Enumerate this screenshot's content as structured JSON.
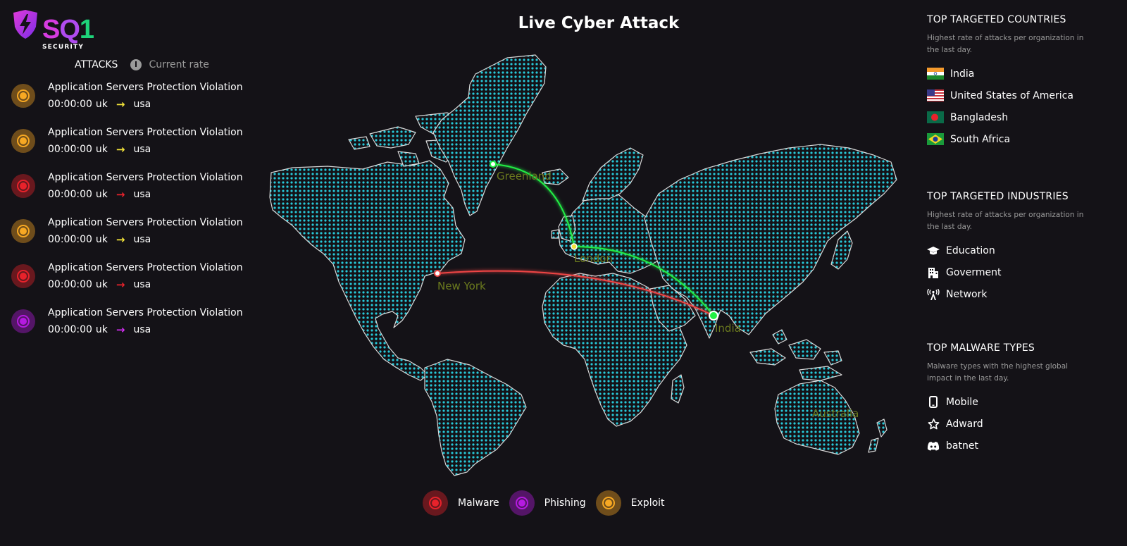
{
  "logo": {
    "text_s": "S",
    "text_q": "Q",
    "text_1": "1",
    "subtitle": "SECURITY"
  },
  "attacks_header": {
    "label": "ATTACKS",
    "rate_label": "Current rate",
    "rate_icon": "gauge-icon"
  },
  "attacks": [
    {
      "name": "Application Servers Protection Violation",
      "time": "00:00:00",
      "from": "uk",
      "to": "usa",
      "type": "exploit",
      "color": "#f7a823",
      "arrow_color": "#f2e33a"
    },
    {
      "name": "Application Servers Protection Violation",
      "time": "00:00:00",
      "from": "uk",
      "to": "usa",
      "type": "exploit",
      "color": "#f7a823",
      "arrow_color": "#f2e33a"
    },
    {
      "name": "Application Servers Protection Violation",
      "time": "00:00:00",
      "from": "uk",
      "to": "usa",
      "type": "malware",
      "color": "#e8222b",
      "arrow_color": "#e8222b"
    },
    {
      "name": "Application Servers Protection Violation",
      "time": "00:00:00",
      "from": "uk",
      "to": "usa",
      "type": "exploit",
      "color": "#f7a823",
      "arrow_color": "#f2e33a"
    },
    {
      "name": "Application Servers Protection Violation",
      "time": "00:00:00",
      "from": "uk",
      "to": "usa",
      "type": "malware",
      "color": "#e8222b",
      "arrow_color": "#e8222b"
    },
    {
      "name": "Application Servers Protection Violation",
      "time": "00:00:00",
      "from": "uk",
      "to": "usa",
      "type": "phishing",
      "color": "#b51be0",
      "arrow_color": "#d02ef0"
    }
  ],
  "title": "Live Cyber Attack",
  "map": {
    "labels": {
      "greenland": "Greenland",
      "new_york": "New York",
      "london": "London",
      "india": "India",
      "australia": "Australia"
    },
    "dot_color": "#27c8d8",
    "border_color": "#d8d8d8",
    "arc_green": "#22ee44",
    "arc_red": "#ef4545",
    "label_color": "#6b7a1e"
  },
  "legend": [
    {
      "label": "Malware",
      "color": "#e8222b"
    },
    {
      "label": "Phishing",
      "color": "#b51be0"
    },
    {
      "label": "Exploit",
      "color": "#f7a823"
    }
  ],
  "targeted_countries": {
    "title": "TOP TARGETED COUNTRIES",
    "description": "Highest rate of attacks per organization in the last day.",
    "items": [
      {
        "label": "India",
        "flag": "india-flag"
      },
      {
        "label": "United States of America",
        "flag": "usa-flag"
      },
      {
        "label": "Bangladesh",
        "flag": "bangladesh-flag"
      },
      {
        "label": "South Africa",
        "flag": "south-africa-flag"
      }
    ]
  },
  "targeted_industries": {
    "title": "TOP TARGETED INDUSTRIES",
    "description": "Highest rate of attacks per organization in the last day.",
    "items": [
      {
        "label": "Education",
        "icon": "graduation-cap-icon"
      },
      {
        "label": "Goverment",
        "icon": "building-icon"
      },
      {
        "label": "Network",
        "icon": "broadcast-tower-icon"
      }
    ]
  },
  "malware_types": {
    "title": "TOP MALWARE TYPES",
    "description": "Malware types with the highest global impact in the last day.",
    "items": [
      {
        "label": "Mobile",
        "icon": "mobile-phone-icon"
      },
      {
        "label": "Adward",
        "icon": "star-icon"
      },
      {
        "label": "batnet",
        "icon": "discord-icon"
      }
    ]
  }
}
